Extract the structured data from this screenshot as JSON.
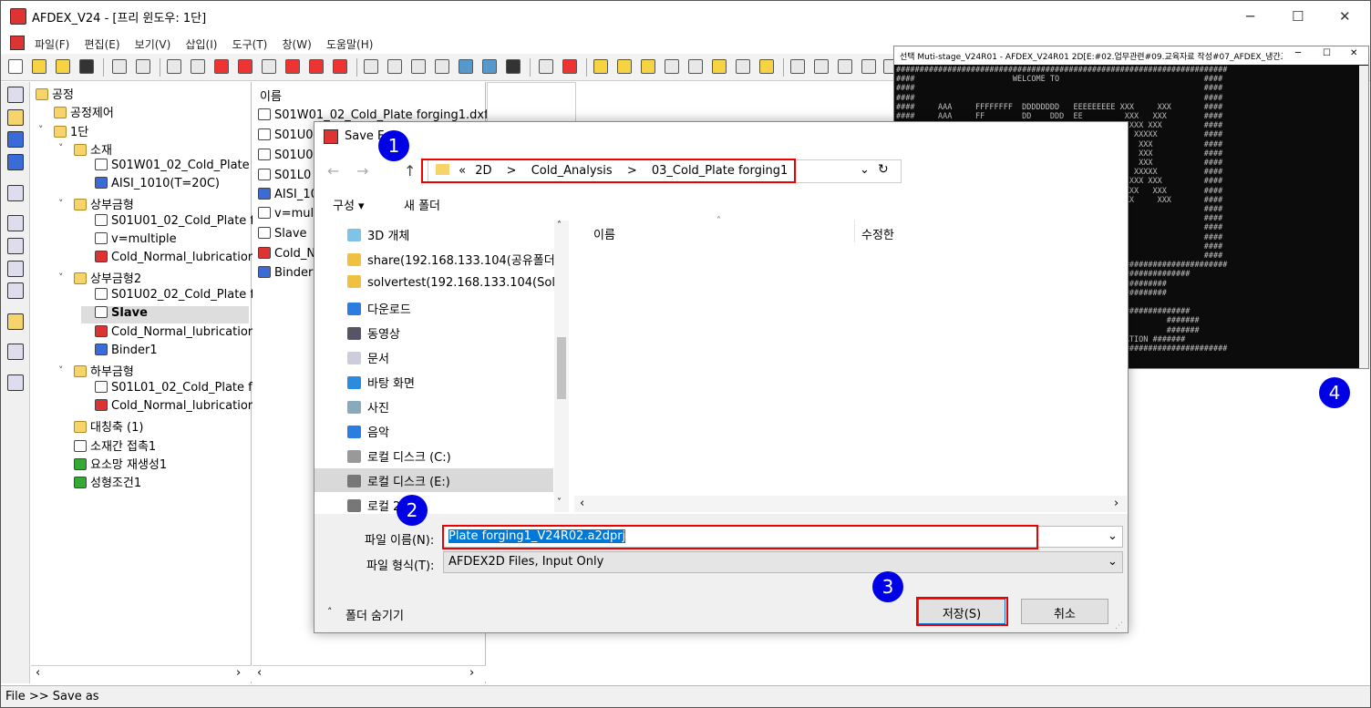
{
  "window": {
    "title": "AFDEX_V24 - [프리 윈도우: 1단]",
    "min": "─",
    "max": "☐",
    "close": "✕"
  },
  "menu": [
    "파일(F)",
    "편집(E)",
    "보기(V)",
    "삽입(I)",
    "도구(T)",
    "창(W)",
    "도움말(H)"
  ],
  "tree": {
    "items": [
      {
        "label": "공정",
        "icon": "folder-open"
      },
      {
        "label": "공정제어",
        "icon": "folder"
      },
      {
        "label": "1단",
        "icon": "folder-open"
      },
      {
        "label": "소재",
        "icon": "cube"
      },
      {
        "label": "S01W01_02_Cold_Plate",
        "icon": "mesh"
      },
      {
        "label": "AISI_1010(T=20C)",
        "icon": "material"
      },
      {
        "label": "상부금형",
        "icon": "die"
      },
      {
        "label": "S01U01_02_Cold_Plate f",
        "icon": "mesh"
      },
      {
        "label": "v=multiple",
        "icon": "press"
      },
      {
        "label": "Cold_Normal_lubricatior",
        "icon": "lubrication"
      },
      {
        "label": "상부금형2",
        "icon": "die"
      },
      {
        "label": "S01U02_02_Cold_Plate f",
        "icon": "mesh"
      },
      {
        "label": "Slave",
        "icon": "press"
      },
      {
        "label": "Cold_Normal_lubricatior",
        "icon": "lubrication"
      },
      {
        "label": "Binder1",
        "icon": "binder"
      },
      {
        "label": "하부금형",
        "icon": "die"
      },
      {
        "label": "S01L01_02_Cold_Plate f",
        "icon": "mesh"
      },
      {
        "label": "Cold_Normal_lubricatior",
        "icon": "lubrication"
      },
      {
        "label": "대칭축 (1)",
        "icon": "axis"
      },
      {
        "label": "소재간 접촉1",
        "icon": "contact"
      },
      {
        "label": "요소망 재생성1",
        "icon": "remesh"
      },
      {
        "label": "성형조건1",
        "icon": "condition"
      }
    ]
  },
  "mid": {
    "header": "이름",
    "items": [
      "S01W01_02_Cold_Plate forging1.dxf",
      "S01U0",
      "S01U0",
      "S01L0",
      "AISI_10",
      "v=mult",
      "Slave",
      "Cold_N",
      "Binder1"
    ]
  },
  "dialog": {
    "title": "Save F",
    "crumb": [
      "«",
      "2D",
      ">",
      "Cold_Analysis",
      ">",
      "03_Cold_Plate forging1"
    ],
    "organize": "구성 ▾",
    "new_folder": "새 폴더",
    "nav": [
      "3D 개체",
      "share(192.168.133.104(공유폴더)",
      "solvertest(192.168.133.104(Solve",
      "다운로드",
      "동영상",
      "문서",
      "바탕 화면",
      "사진",
      "음악",
      "로컬 디스크 (C:)",
      "로컬 디스크 (E:)",
      "로컬 2 (F:)"
    ],
    "col_name": "이름",
    "col_mod": "수정한",
    "filename_label": "파일 이름(N):",
    "filename": "Plate forging1_V24R02.a2dprj",
    "filetype_label": "파일 형식(T):",
    "filetype": "AFDEX2D Files, Input Only",
    "hide_folders": "폴더 숨기기",
    "save": "저장(S)",
    "cancel": "취소"
  },
  "console": {
    "title": "선택 Muti-stage_V24R01 - AFDEX_V24R01 2D[E:#02.업무관련#09.교육자료 작성#07_AFDEX_냉간교육자...",
    "text": "#######################################################################\n####                     WELCOME TO                               ####\n####                                                              ####\n####                                                              ####\n####     AAA     FFFFFFFF  DDDDDDDD   EEEEEEEEE XXX     XXX       ####\n####     AAA     FF        DD    DDD  EE         XXX   XXX        ####\n####    AAAAA    FF        DD     DD  EE          XXX XXX         ####\n####    AA AA    FF        DD     DDD EE           XXXXX          ####\n####   AAA AAA   FF        DD      DD EE            XXX           ####\n####   AA   AA   FFFFFFF   DD      DD EEEEEEEE      XXX           ####\n####  AAAAAAA    FF        DD      DD EE            XXX           ####\n#### AAA   AAA   FF        DD     DDD EE           XXXXX          ####\n#### AA     AA   FF        DD     DD  EE          XXX XXX         ####\n####AAA     AAA  FF        DD    DDD  EE         XXX   XXX        ####\n####AA       AA  FF        DDDDDDDD   EEEEEEEEE XXX     XXX       ####\n####                                                              ####\n####                                                              ####\n####                    Email:  mfrc@afdex.com                    ####\n####                 Homepage:  www.afdex.com                     ####\n####                                                              ####\n####                                                              ####\n#######################################################################\n     ##########################################################\n          ################################################\n          ################################################\n\n     ##########################################################\n#######                                                   #######\n#######              From Oct. 15, 1998                   #######\n####### Forging competitiveness depends on  SIMULATION #######\n#######################################################################"
  },
  "badges": [
    "1",
    "2",
    "3",
    "4"
  ],
  "status": "File >> Save as"
}
